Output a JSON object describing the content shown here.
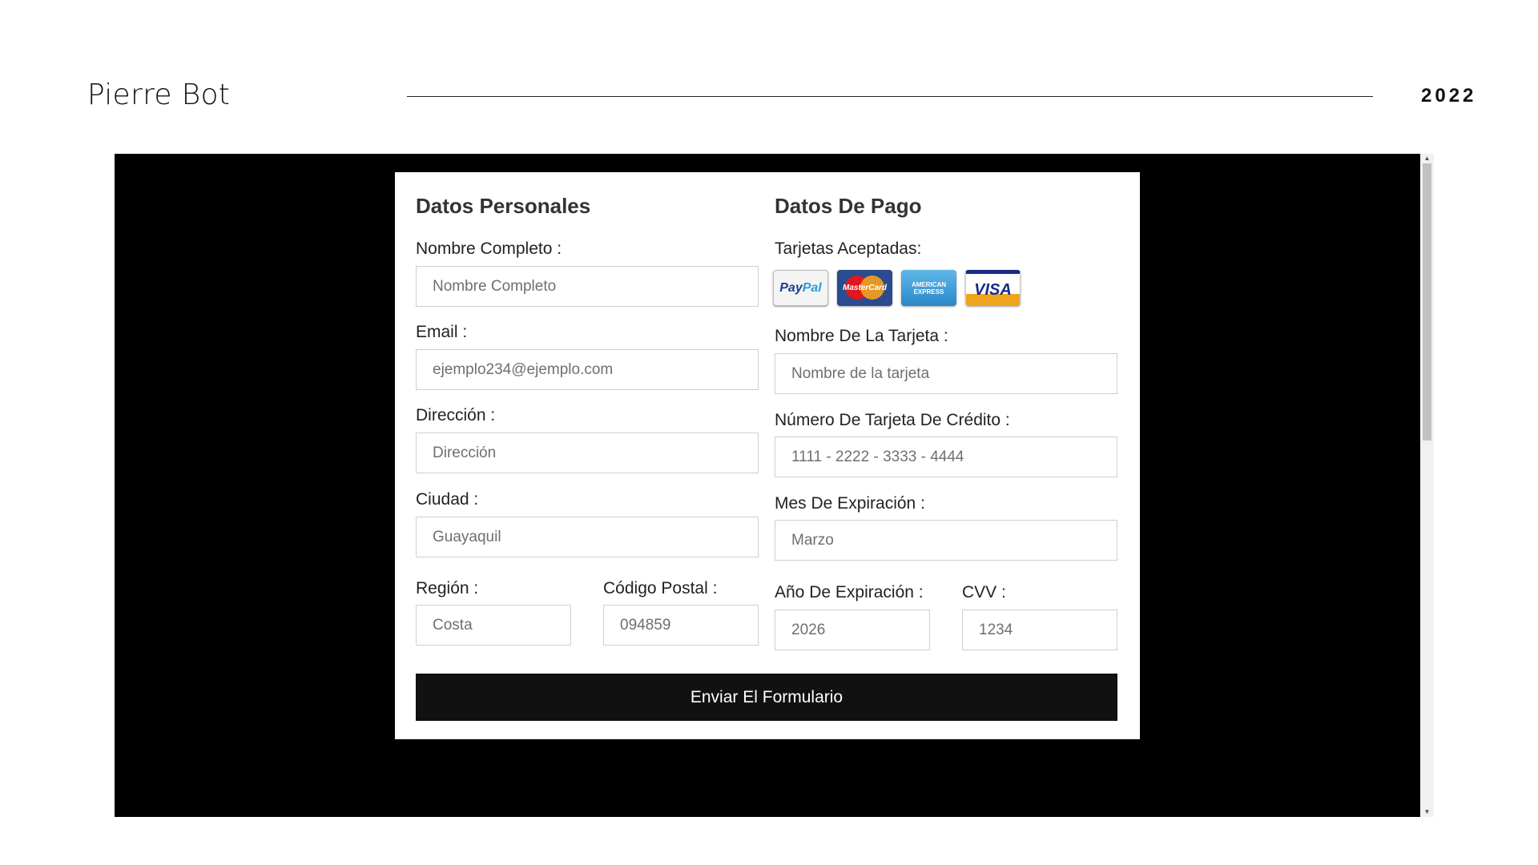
{
  "slide": {
    "author": "Pierre Bot",
    "year": "2022"
  },
  "form": {
    "personal": {
      "title": "Datos Personales",
      "full_name": {
        "label": "Nombre Completo :",
        "placeholder": "Nombre Completo"
      },
      "email": {
        "label": "Email :",
        "placeholder": "ejemplo234@ejemplo.com"
      },
      "address": {
        "label": "Dirección :",
        "placeholder": "Dirección"
      },
      "city": {
        "label": "Ciudad :",
        "placeholder": "Guayaquil"
      },
      "region": {
        "label": "Región :",
        "placeholder": "Costa"
      },
      "postal_code": {
        "label": "Código Postal :",
        "placeholder": "094859"
      }
    },
    "payment": {
      "title": "Datos De Pago",
      "accepted_cards": {
        "label": "Tarjetas Aceptadas:",
        "cards": [
          {
            "name": "PayPal",
            "icon": "paypal-icon",
            "text_a": "Pay",
            "text_b": "Pal"
          },
          {
            "name": "MasterCard",
            "icon": "mastercard-icon",
            "text": "MasterCard"
          },
          {
            "name": "American Express",
            "icon": "amex-icon",
            "text_a": "AMERICAN",
            "text_b": "EXPRESS"
          },
          {
            "name": "Visa",
            "icon": "visa-icon",
            "text": "VISA"
          }
        ]
      },
      "card_name": {
        "label": "Nombre De La Tarjeta :",
        "placeholder": "Nombre de la tarjeta"
      },
      "card_number": {
        "label": "Número De Tarjeta De Crédito :",
        "placeholder": "1111 - 2222 - 3333 - 4444"
      },
      "exp_month": {
        "label": "Mes De Expiración :",
        "placeholder": "Marzo"
      },
      "exp_year": {
        "label": "Año De Expiración :",
        "placeholder": "2026"
      },
      "cvv": {
        "label": "CVV :",
        "placeholder": "1234"
      }
    },
    "submit_label": "Enviar El Formulario"
  },
  "scrollbar": {
    "up_arrow": "▲",
    "down_arrow": "▼"
  },
  "colors": {
    "frame_background": "#000000",
    "button_background": "#111111",
    "field_border": "#cfcfcf"
  }
}
